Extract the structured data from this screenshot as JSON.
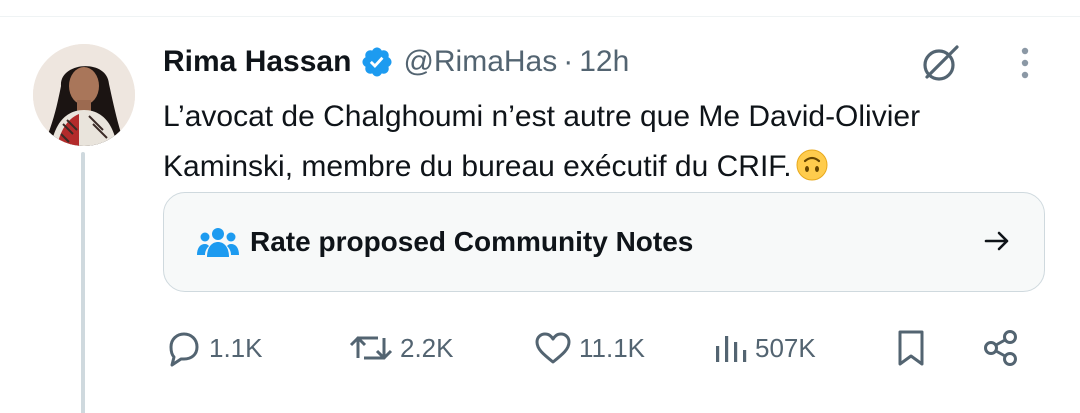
{
  "tweet": {
    "author": {
      "display_name": "Rima Hassan",
      "handle": "@RimaHas",
      "verified": true,
      "avatar_icon": "profile-photo"
    },
    "separator": "·",
    "timestamp": "12h",
    "text_line1": "L’avocat de Chalghoumi n’est autre que Me David-Olivier",
    "text_line2": "Kaminski, membre du bureau exécutif du CRIF.",
    "emoji": "upside-down-face",
    "community_notes": {
      "icon": "people-icon",
      "label": "Rate proposed Community Notes",
      "arrow_icon": "arrow-right-icon"
    },
    "actions": {
      "replies": "1.1K",
      "reposts": "2.2K",
      "likes": "11.1K",
      "views": "507K",
      "bookmark_icon": "bookmark-icon",
      "share_icon": "share-icon"
    }
  },
  "colors": {
    "text_primary": "#0f1419",
    "text_secondary": "#536471",
    "verified_blue": "#1d9bf0",
    "card_bg": "#f7f9f9",
    "border": "#cfd9de"
  }
}
